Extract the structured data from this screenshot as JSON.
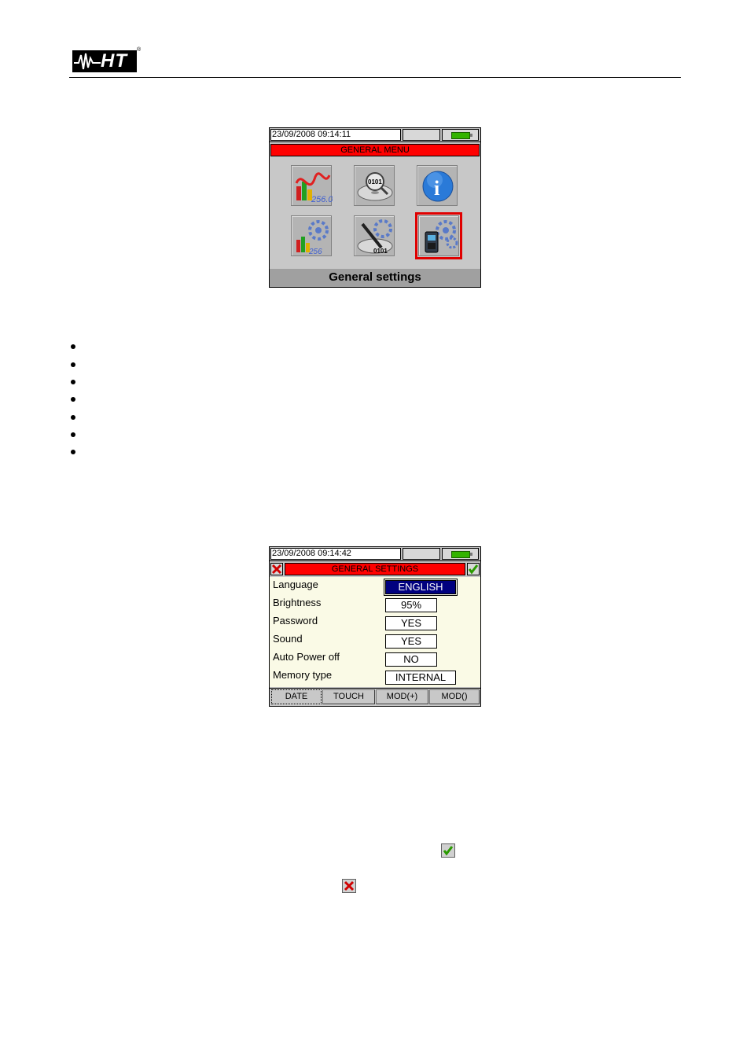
{
  "header": {
    "logo_text": "HT",
    "logo_mark": "®"
  },
  "general_menu": {
    "datetime": "23/09/2008 09:14:11",
    "title": "GENERAL MENU",
    "icons": [
      {
        "name": "analyzer-settings-icon",
        "text": "256.0"
      },
      {
        "name": "recall-data-icon",
        "text": "0101"
      },
      {
        "name": "info-icon",
        "text": "i"
      },
      {
        "name": "analyzer-config-icon",
        "text": "256"
      },
      {
        "name": "pc-connection-icon",
        "text": "0101"
      },
      {
        "name": "general-settings-icon",
        "text": ""
      }
    ],
    "selected_label": "General settings"
  },
  "general_settings": {
    "datetime": "23/09/2008 09:14:42",
    "title": "GENERAL SETTINGS",
    "rows": [
      {
        "label": "Language",
        "value": "ENGLISH"
      },
      {
        "label": "Brightness",
        "value": "95%"
      },
      {
        "label": "Password",
        "value": "YES"
      },
      {
        "label": "Sound",
        "value": "YES"
      },
      {
        "label": "Auto Power off",
        "value": "NO"
      },
      {
        "label": "Memory type",
        "value": "INTERNAL"
      }
    ],
    "softkeys": [
      "DATE",
      "TOUCH",
      "MOD(+)",
      "MOD()"
    ]
  },
  "colors": {
    "title_red": "#ff0000",
    "selection_blue": "#00007f",
    "confirm_green": "#2a9a00",
    "cancel_red": "#d00000"
  }
}
